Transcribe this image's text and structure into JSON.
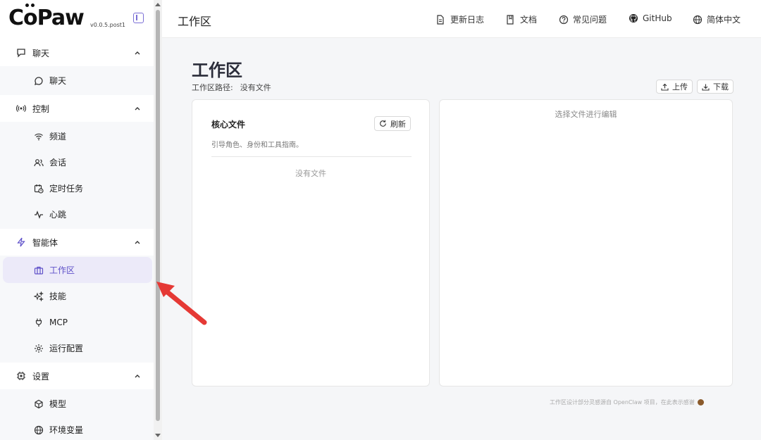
{
  "sidebar": {
    "logo": "CoPaw",
    "version": "v0.0.5.post1",
    "groups": [
      {
        "label": "聊天",
        "icon": "chat-icon",
        "items": [
          {
            "label": "聊天",
            "icon": "chat-bubble-icon"
          }
        ]
      },
      {
        "label": "控制",
        "icon": "broadcast-icon",
        "items": [
          {
            "label": "频道",
            "icon": "wifi-icon"
          },
          {
            "label": "会话",
            "icon": "users-icon"
          },
          {
            "label": "定时任务",
            "icon": "calendar-clock-icon"
          },
          {
            "label": "心跳",
            "icon": "pulse-icon"
          }
        ]
      },
      {
        "label": "智能体",
        "icon": "lightning-icon",
        "items": [
          {
            "label": "工作区",
            "icon": "briefcase-icon",
            "active": true
          },
          {
            "label": "技能",
            "icon": "sparkles-icon"
          },
          {
            "label": "MCP",
            "icon": "plug-icon"
          },
          {
            "label": "运行配置",
            "icon": "gear-icon"
          }
        ]
      },
      {
        "label": "设置",
        "icon": "chip-icon",
        "items": [
          {
            "label": "模型",
            "icon": "cube-icon"
          },
          {
            "label": "环境变量",
            "icon": "globe-icon"
          }
        ]
      }
    ]
  },
  "topbar": {
    "title": "工作区",
    "links": [
      {
        "label": "更新日志",
        "icon": "document-icon"
      },
      {
        "label": "文档",
        "icon": "book-icon"
      },
      {
        "label": "常见问题",
        "icon": "question-icon"
      },
      {
        "label": "GitHub",
        "icon": "github-icon"
      },
      {
        "label": "简体中文",
        "icon": "globe-icon"
      }
    ]
  },
  "main": {
    "title": "工作区",
    "path_label": "工作区路径:",
    "path_value": "没有文件",
    "upload_label": "上传",
    "download_label": "下载",
    "core_files": {
      "title": "核心文件",
      "refresh_label": "刷新",
      "description": "引导角色、身份和工具指南。",
      "empty_text": "没有文件"
    },
    "editor": {
      "hint": "选择文件进行编辑"
    },
    "footer_note": "工作区设计部分灵感源自 OpenClaw 项目，在此表示感谢"
  },
  "colors": {
    "accent": "#5f51c9",
    "active_bg": "#eceaf9",
    "annotation_arrow": "#e53935"
  }
}
